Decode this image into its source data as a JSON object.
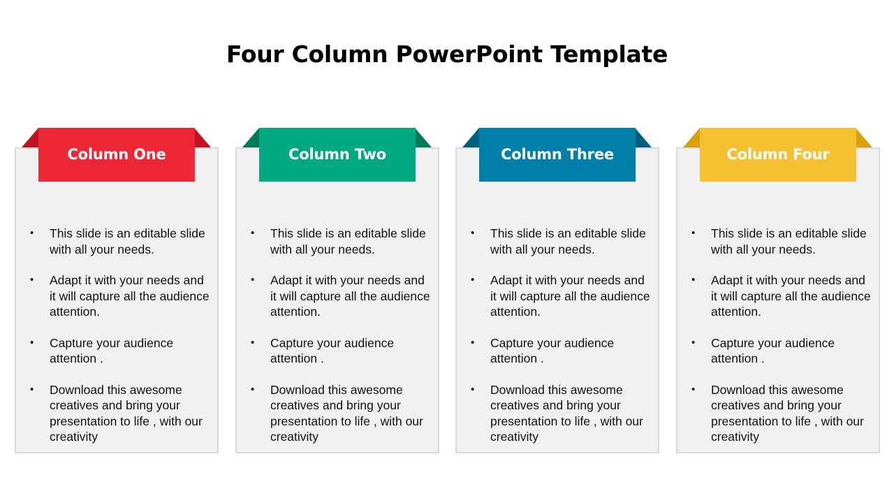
{
  "slide": {
    "title": "Four Column PowerPoint Template"
  },
  "columns": [
    {
      "heading": "Column One",
      "color": "#ee2737",
      "fold_color": "#c1121f",
      "bullets": [
        "This slide is an editable slide with all your needs.",
        "Adapt it with your needs and it will capture all the audience attention.",
        "Capture your audience attention .",
        "Download this awesome creatives and bring your presentation to life , with our creativity"
      ]
    },
    {
      "heading": "Column Two",
      "color": "#00a97f",
      "fold_color": "#007a5a",
      "bullets": [
        "This slide is an editable slide with all your needs.",
        "Adapt it with your needs and it will capture all the audience attention.",
        "Capture your audience attention .",
        "Download this awesome creatives and bring your presentation to life , with our creativity"
      ]
    },
    {
      "heading": "Column Three",
      "color": "#0080a9",
      "fold_color": "#005f80",
      "bullets": [
        "This slide is an editable slide with all your needs.",
        "Adapt it with your needs and it will capture all the audience attention.",
        "Capture your audience attention .",
        "Download this awesome creatives and bring your presentation to life , with our creativity"
      ]
    },
    {
      "heading": "Column Four",
      "color": "#f6c033",
      "fold_color": "#dba010",
      "bullets": [
        "This slide is an editable slide with all your needs.",
        "Adapt it with your needs and it will capture all the audience attention.",
        "Capture your audience attention .",
        "Download this awesome creatives and bring your presentation to life , with our creativity"
      ]
    }
  ],
  "bullet_glyph": "•"
}
